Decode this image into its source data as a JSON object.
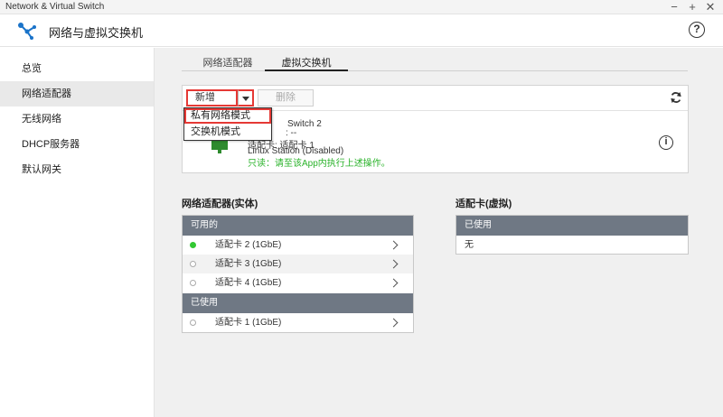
{
  "window": {
    "title": "Network & Virtual Switch"
  },
  "app": {
    "title": "网络与虚拟交换机"
  },
  "sidebar": {
    "items": [
      {
        "label": "总览"
      },
      {
        "label": "网络适配器"
      },
      {
        "label": "无线网络"
      },
      {
        "label": "DHCP服务器"
      },
      {
        "label": "默认网关"
      }
    ]
  },
  "tabs": [
    {
      "label": "网络适配器"
    },
    {
      "label": "虚拟交换机"
    }
  ],
  "toolbar": {
    "add_label": "新增",
    "delete_label": "删除"
  },
  "dropdown": {
    "items": [
      "私有网络模式",
      "交换机模式"
    ]
  },
  "switch_card": {
    "name": "Switch 2",
    "ip": ": --",
    "adapter": "适配卡: 适配卡 1",
    "app": "Linux Station (Disabled)",
    "readonly_note": "只读：请至该App内执行上述操作。"
  },
  "physical": {
    "title": "网络适配器(实体)",
    "available_header": "可用的",
    "available": [
      {
        "label": "适配卡 2 (1GbE)",
        "active": true
      },
      {
        "label": "适配卡 3 (1GbE)",
        "active": false
      },
      {
        "label": "适配卡 4 (1GbE)",
        "active": false
      }
    ],
    "used_header": "已使用",
    "used": [
      {
        "label": "适配卡 1 (1GbE)",
        "active": false
      }
    ]
  },
  "virtual": {
    "title": "适配卡(虚拟)",
    "used_header": "已使用",
    "empty_label": "无"
  },
  "colors": {
    "accent_red": "#e53935",
    "header_gray": "#6f7884",
    "status_green": "#32c832"
  }
}
